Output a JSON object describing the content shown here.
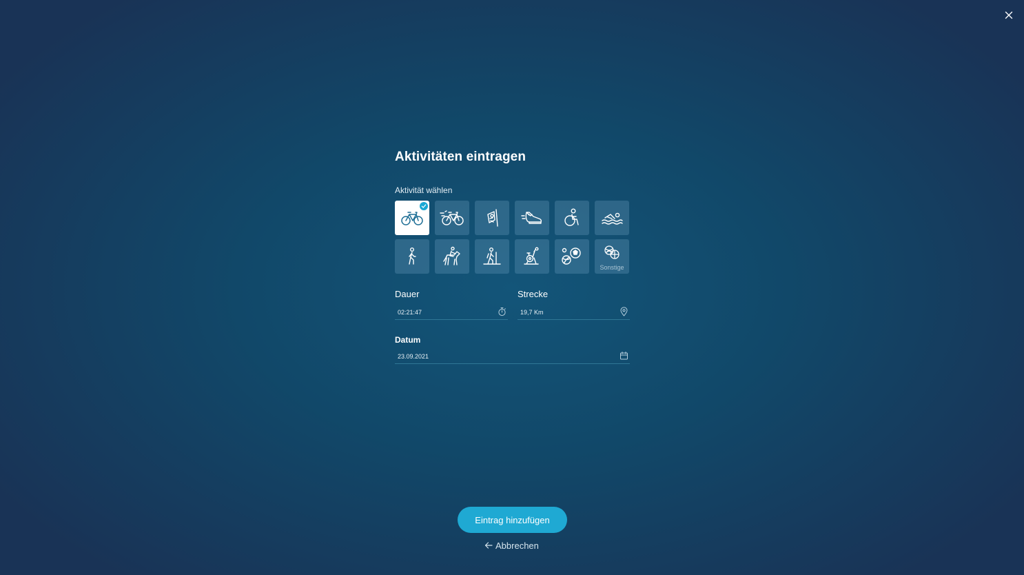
{
  "dialog": {
    "title": "Aktivitäten eintragen",
    "activity_label": "Aktivität wählen",
    "close_icon": "close-icon"
  },
  "activities": [
    {
      "icon": "bicycle-icon",
      "selected": true
    },
    {
      "icon": "fast-bicycle-icon",
      "selected": false
    },
    {
      "icon": "workout-icon",
      "selected": false
    },
    {
      "icon": "running-shoe-icon",
      "selected": false
    },
    {
      "icon": "wheelchair-icon",
      "selected": false
    },
    {
      "icon": "swimming-icon",
      "selected": false
    },
    {
      "icon": "walking-icon",
      "selected": false
    },
    {
      "icon": "horse-riding-icon",
      "selected": false
    },
    {
      "icon": "hiking-icon",
      "selected": false
    },
    {
      "icon": "exercise-bike-icon",
      "selected": false
    },
    {
      "icon": "ball-sports-icon",
      "selected": false
    },
    {
      "icon": "other-sports-icon",
      "selected": false,
      "caption": "Sonstige"
    }
  ],
  "fields": {
    "duration": {
      "label": "Dauer",
      "value": "02:21:47",
      "icon": "stopwatch-icon"
    },
    "distance": {
      "label": "Strecke",
      "value": "19,7 Km",
      "icon": "location-pin-icon"
    },
    "date": {
      "label": "Datum",
      "value": "23.09.2021",
      "icon": "calendar-icon"
    }
  },
  "actions": {
    "submit_label": "Eintrag hinzufügen",
    "cancel_label": "Abbrechen"
  },
  "colors": {
    "accent": "#1fa9d3",
    "background": "#114869",
    "tile": "#3b6f8e"
  }
}
